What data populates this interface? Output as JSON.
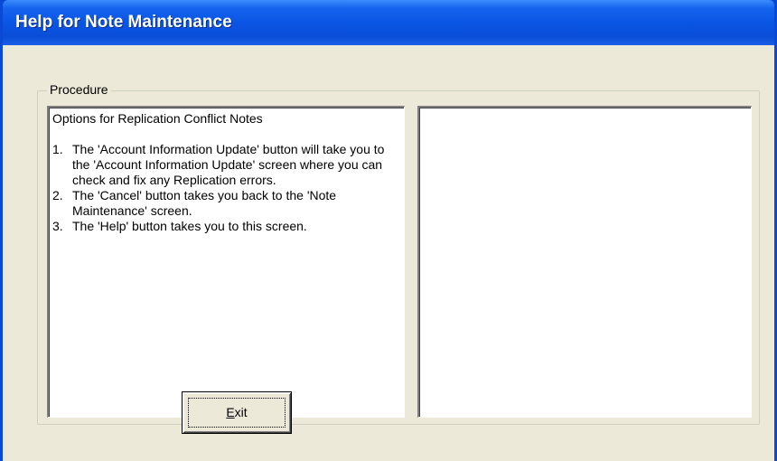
{
  "window": {
    "title": "Help for Note Maintenance"
  },
  "procedure": {
    "group_label": "Procedure",
    "heading": "Options for Replication Conflict Notes",
    "steps": [
      {
        "num": "1.",
        "text": "The 'Account Information Update' button will take you to the 'Account Information Update' screen where you can check and fix any Replication errors."
      },
      {
        "num": "2.",
        "text": "The 'Cancel' button takes you back to the 'Note Maintenance' screen."
      },
      {
        "num": "3.",
        "text": "The 'Help' button takes you to this screen."
      }
    ],
    "right_pane_text": ""
  },
  "buttons": {
    "exit_label": "Exit",
    "exit_accelerator": "E"
  },
  "colors": {
    "titlebar": "#0a55e4",
    "client_bg": "#ece9d8"
  }
}
